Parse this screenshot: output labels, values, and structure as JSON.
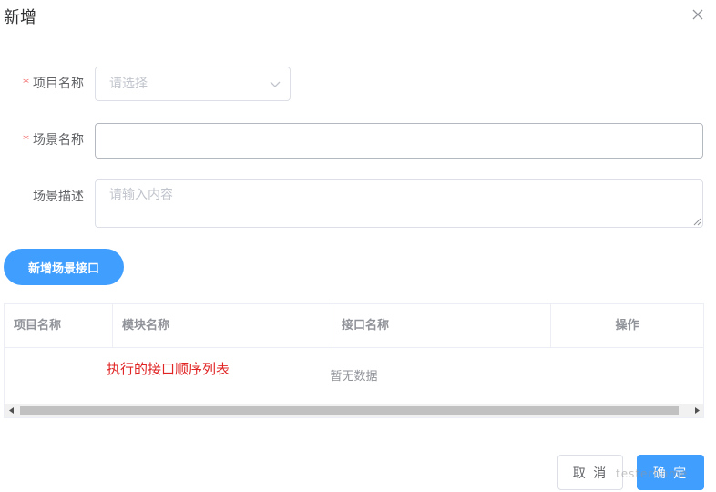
{
  "dialog": {
    "title": "新增"
  },
  "form": {
    "required_mark": "*",
    "project": {
      "label": "项目名称",
      "placeholder": "请选择"
    },
    "scene_name": {
      "label": "场景名称",
      "value": ""
    },
    "scene_desc": {
      "label": "场景描述",
      "placeholder": "请输入内容"
    }
  },
  "add_button": {
    "label": "新增场景接口"
  },
  "table": {
    "columns": [
      "项目名称",
      "模块名称",
      "接口名称",
      "操作"
    ],
    "empty_text": "暂无数据",
    "annotation": "执行的接口顺序列表"
  },
  "footer": {
    "cancel_label": "取 消",
    "confirm_label": "确 定"
  },
  "watermark": {
    "text": "testerhome"
  },
  "colors": {
    "primary": "#409eff",
    "required": "#f56c6c",
    "annotation": "#e02424"
  },
  "icons": {
    "close": "close-icon",
    "chevron": "chevron-down-icon"
  }
}
